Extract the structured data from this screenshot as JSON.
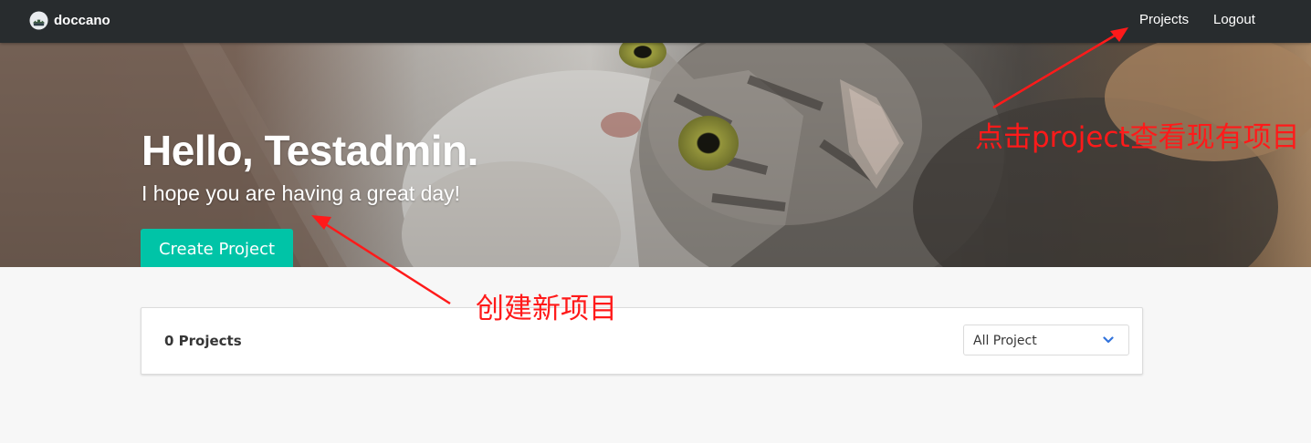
{
  "navbar": {
    "brand": "doccano",
    "links": [
      "Projects",
      "Logout"
    ]
  },
  "hero": {
    "title": "Hello, Testadmin.",
    "subtitle": "I hope you are having a great day!",
    "create_button": "Create Project"
  },
  "projects_panel": {
    "count_label": "0 Projects",
    "filter": {
      "selected": "All Project"
    }
  },
  "annotations": {
    "projects_hint": "点击project查看现有项目",
    "create_hint": "创建新项目"
  },
  "colors": {
    "navbar_bg": "#282c2e",
    "primary_button": "#00c4a7",
    "annotation_red": "#ff1a1a",
    "page_bg": "#f7f7f7"
  },
  "icons": {
    "brand_logo": "doccano-logo-icon",
    "select_chevron": "chevron-down-icon"
  }
}
